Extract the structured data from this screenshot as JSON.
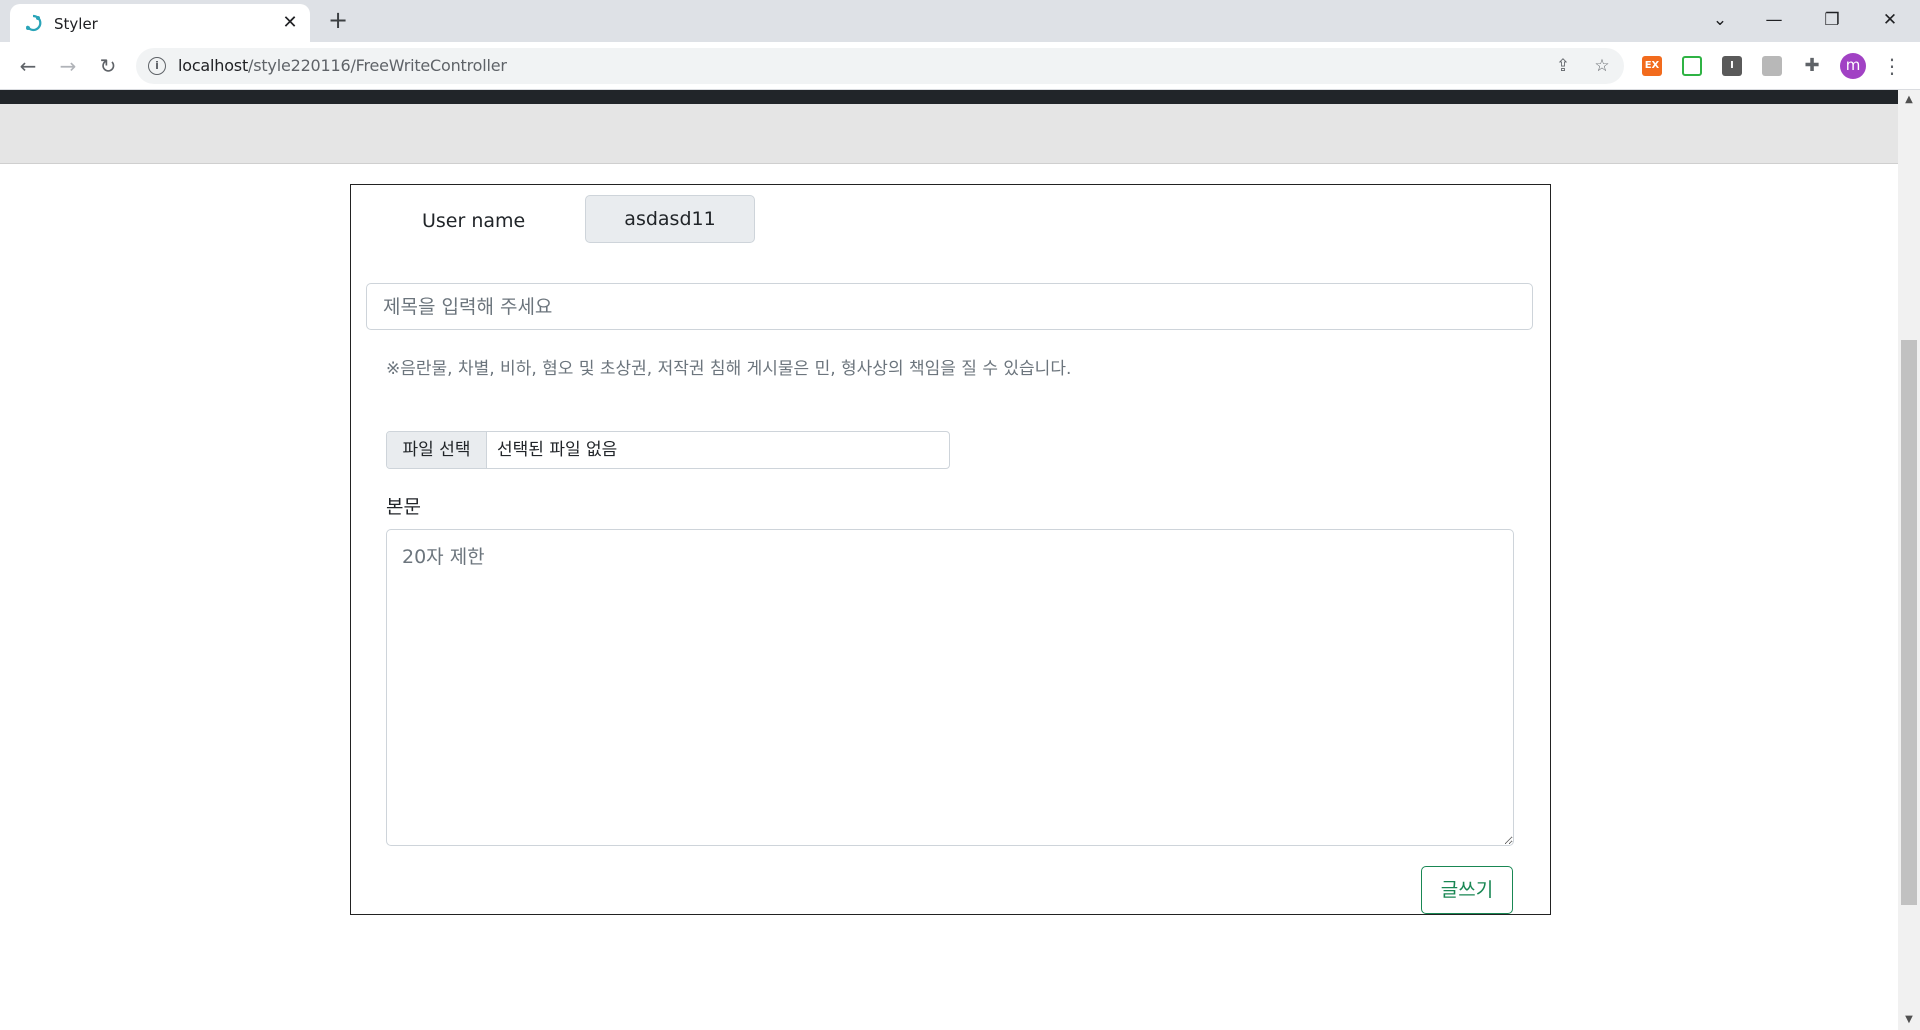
{
  "browser": {
    "tab_title": "Styler",
    "url_host": "localhost",
    "url_path": "/style220116/FreeWriteController",
    "avatar_letter": "m",
    "ext_label": "EX"
  },
  "form": {
    "user_label": "User name",
    "user_value": "asdasd11",
    "title_placeholder": "제목을 입력해 주세요",
    "notice": "※음란물, 차별, 비하, 혐오 및 초상권, 저작권 침해 게시물은 민, 형사상의 책임을 질 수 있습니다.",
    "file_button": "파일 선택",
    "file_status": "선택된 파일 없음",
    "body_label": "본문",
    "body_placeholder": "20자 제한",
    "submit_label": "글쓰기"
  },
  "colors": {
    "accent_green": "#198754",
    "avatar_purple": "#a142c4",
    "dark_bar": "#212529"
  }
}
